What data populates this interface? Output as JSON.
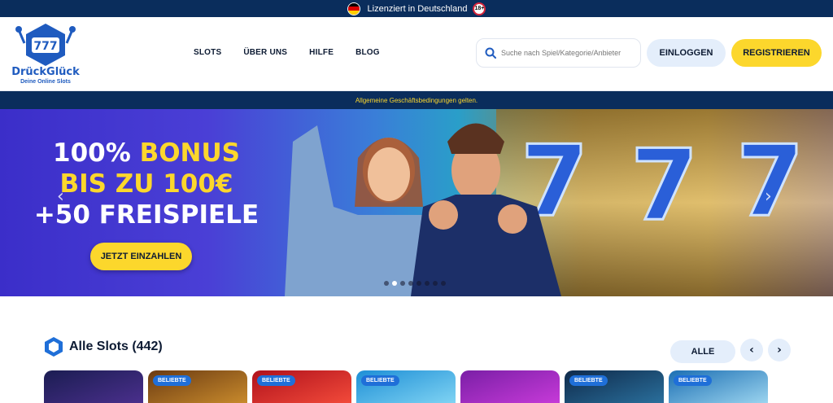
{
  "license_bar": {
    "text": "Lizenziert in Deutschland",
    "age_badge": "18+"
  },
  "brand": {
    "name": "DrückGlück",
    "tagline": "Deine Online Slots",
    "slot_digits": "777"
  },
  "nav": {
    "items": [
      "SLOTS",
      "ÜBER UNS",
      "HILFE",
      "BLOG"
    ]
  },
  "search": {
    "placeholder": "Suche nach Spiel/Kategorie/Anbieter",
    "icon": "search-icon"
  },
  "auth": {
    "login_label": "EINLOGGEN",
    "register_label": "REGISTRIEREN"
  },
  "agb_bar": {
    "text": "Allgemeine Geschäftsbedingungen gelten."
  },
  "hero": {
    "line1_white": "100% ",
    "line1_yellow": "BONUS",
    "line2": "BIS ZU 100€",
    "line3": "+50 FREISPIELE",
    "cta_label": "JETZT EINZAHLEN",
    "prev_arrow": "‹",
    "next_arrow": "›",
    "slide_count": 8,
    "active_slide": 1
  },
  "slots_section": {
    "title": "Alle Slots (442)",
    "filter_label": "ALLE",
    "prev_label": "‹",
    "next_label": "›",
    "tiles": [
      {
        "badge": "",
        "color_a": "#1b1d52",
        "color_b": "#4a2f8c"
      },
      {
        "badge": "BELIEBTE",
        "color_a": "#6b3b12",
        "color_b": "#c88a2c"
      },
      {
        "badge": "BELIEBTE",
        "color_a": "#b0121c",
        "color_b": "#f24a3a"
      },
      {
        "badge": "BELIEBTE",
        "color_a": "#1e8fd6",
        "color_b": "#7fd3f3"
      },
      {
        "badge": "",
        "color_a": "#7a1fa6",
        "color_b": "#c63ad8"
      },
      {
        "badge": "BELIEBTE",
        "color_a": "#0f2a4a",
        "color_b": "#2a6f9c"
      },
      {
        "badge": "BELIEBTE",
        "color_a": "#1c6fb3",
        "color_b": "#9bd4ef"
      }
    ]
  },
  "colors": {
    "navy": "#0a2d5c",
    "yellow": "#fcd72c",
    "light_blue": "#e4eefb",
    "brand_blue": "#1f5bbf"
  }
}
